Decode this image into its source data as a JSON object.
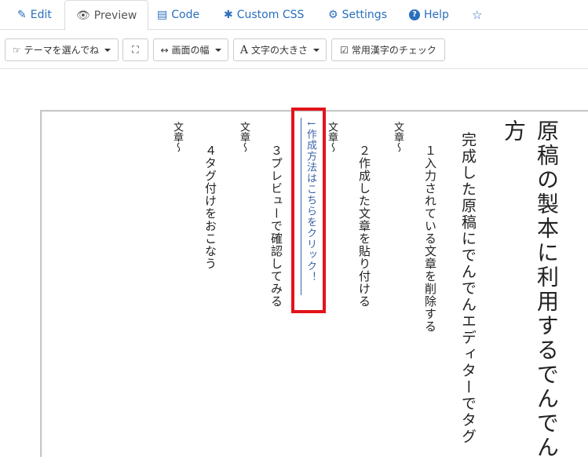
{
  "tabs": [
    {
      "icon": "✎",
      "label": "Edit"
    },
    {
      "icon": "👁",
      "label": "Preview"
    },
    {
      "icon": "▤",
      "label": "Code"
    },
    {
      "icon": "✱",
      "label": "Custom CSS"
    },
    {
      "icon": "⚙",
      "label": "Settings"
    },
    {
      "icon": "?",
      "label": "Help"
    },
    {
      "icon": "☆",
      "label": ""
    }
  ],
  "toolbar": {
    "theme": {
      "icon": "☞",
      "label": "テーマを選んでね"
    },
    "fullscreen": {
      "icon": "⛶"
    },
    "width": {
      "icon": "↔",
      "label": "画面の幅"
    },
    "fontsize": {
      "icon": "A",
      "label": "文字の大きさ"
    },
    "kanji": {
      "icon": "☑",
      "label": "常用漢字のチェック"
    }
  },
  "manuscript": {
    "title_col1": "原稿の製本に利用するでんでん",
    "title_col2": "方",
    "subtitle": "完成した原稿にでんでんエディターでタグ",
    "item1": "１入力されている文章を削除する",
    "item1_note": "文章〜",
    "item2": "２作成した文章を貼り付ける",
    "item2_note": "文章〜",
    "link": "↓作成方法はこちらをクリック！",
    "item3": "３プレビューで確認してみる",
    "item3_note": "文章〜",
    "item4": "４タグ付けをおこなう",
    "item4_note": "文章〜"
  },
  "colors": {
    "highlight": "#e3131b",
    "link": "#3a63a8",
    "tab_link": "#2a6ebd"
  }
}
